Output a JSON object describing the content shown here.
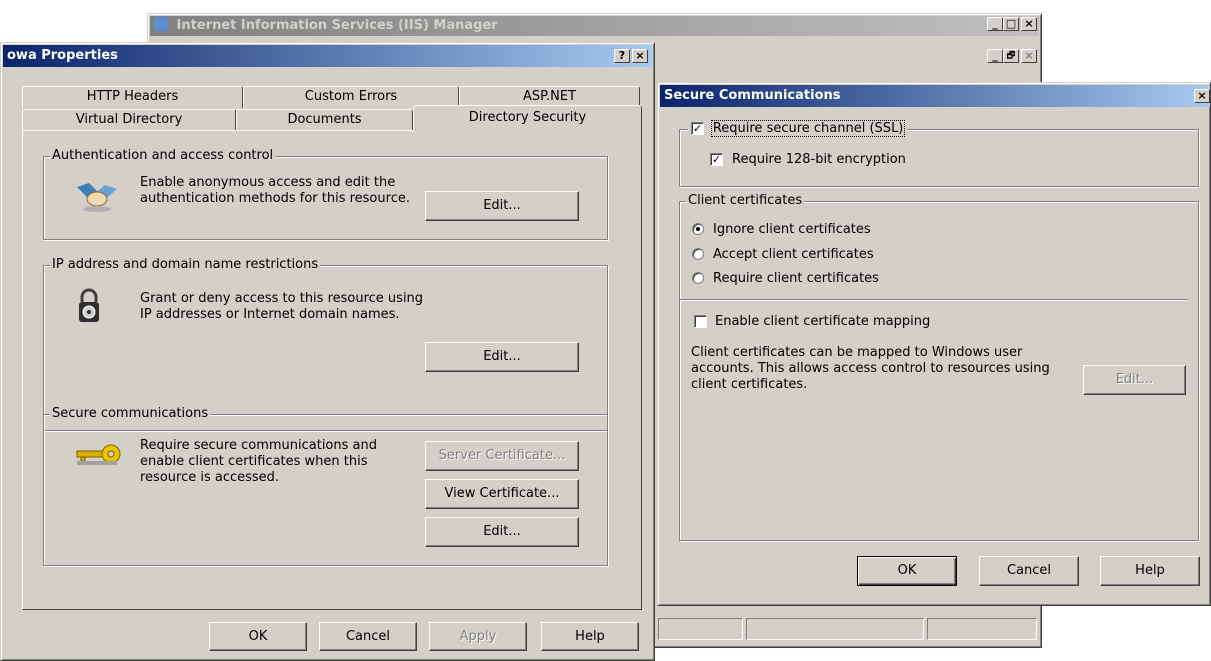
{
  "iis": {
    "title": "Internet Information Services (IIS) Manager",
    "caption": {
      "minimize": "_",
      "maximize": "□",
      "close": "×",
      "restore": "🗗"
    }
  },
  "props": {
    "title": "owa Properties",
    "caption": {
      "help": "?",
      "close": "×"
    },
    "tabs_row1": [
      "HTTP Headers",
      "Custom Errors",
      "ASP.NET"
    ],
    "tabs_row2": [
      "Virtual Directory",
      "Documents",
      "Directory Security"
    ],
    "auth": {
      "group_label": "Authentication and access control",
      "desc_line1": "Enable anonymous access and edit the",
      "desc_line2": "authentication methods for this resource.",
      "edit": "Edit..."
    },
    "ip": {
      "group_label": "IP address and domain name restrictions",
      "desc_line1": "Grant or deny access to this resource using",
      "desc_line2": "IP addresses or Internet domain names.",
      "edit": "Edit..."
    },
    "secure": {
      "group_label": "Secure communications",
      "desc_line1": "Require secure communications and",
      "desc_line2": "enable client certificates when this",
      "desc_line3": "resource is accessed.",
      "server_cert": "Server Certificate...",
      "view_cert": "View Certificate...",
      "edit": "Edit..."
    },
    "buttons": {
      "ok": "OK",
      "cancel": "Cancel",
      "apply": "Apply",
      "help": "Help"
    }
  },
  "secure_dialog": {
    "title": "Secure Communications",
    "close": "×",
    "require_ssl": {
      "label": "Require secure channel (SSL)",
      "checked": true
    },
    "require_128": {
      "label": "Require 128-bit encryption",
      "checked": true
    },
    "client_certs": {
      "group_label": "Client certificates",
      "options": [
        "Ignore client certificates",
        "Accept client certificates",
        "Require client certificates"
      ],
      "selected": "Ignore client certificates"
    },
    "mapping": {
      "label": "Enable client certificate mapping",
      "checked": false
    },
    "mapping_desc_line1": "Client certificates can be mapped to Windows user",
    "mapping_desc_line2": "accounts.  This allows access control to resources using",
    "mapping_desc_line3": "client certificates.",
    "mapping_edit": "Edit...",
    "buttons": {
      "ok": "OK",
      "cancel": "Cancel",
      "help": "Help"
    }
  }
}
